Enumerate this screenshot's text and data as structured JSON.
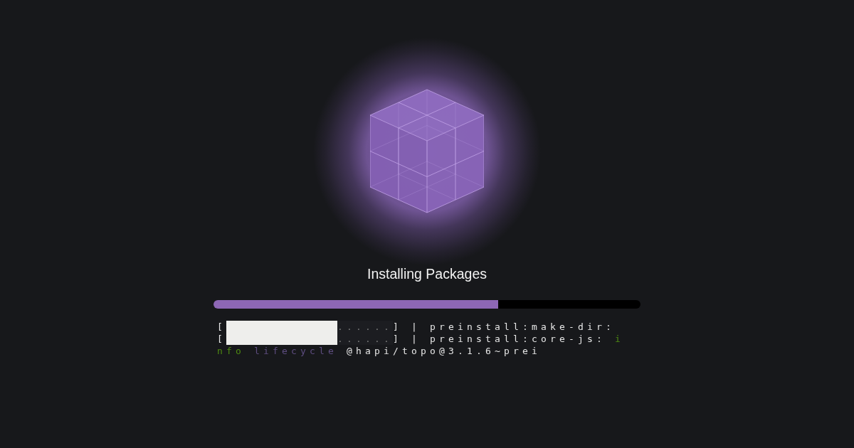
{
  "installer": {
    "title": "Installing Packages",
    "progress": {
      "level": 0.667
    }
  },
  "log": {
    "lines": [
      {
        "segments": [
          {
            "kind": "gauge",
            "open": "[",
            "level": 0.667,
            "rest": "......",
            "close": "]"
          },
          {
            "kind": "text",
            "text": "| preinstall:make-dir:"
          }
        ]
      },
      {
        "segments": [
          {
            "kind": "gauge",
            "open": "[",
            "level": 0.667,
            "rest": "......",
            "close": "]"
          },
          {
            "kind": "text",
            "text": "| preinstall:core-js:"
          },
          {
            "kind": "level",
            "text": "i"
          }
        ]
      },
      {
        "segments": [
          {
            "kind": "level",
            "text": "nfo"
          },
          {
            "kind": "prefix",
            "text": "lifecycle"
          },
          {
            "kind": "text",
            "text": "@hapi/topo@3.1.6~prei"
          }
        ]
      }
    ]
  }
}
